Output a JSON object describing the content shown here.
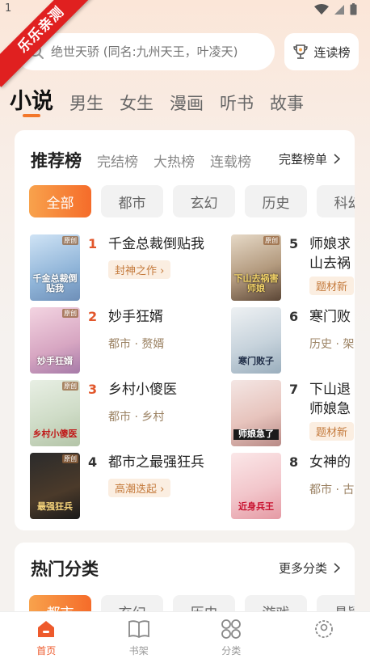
{
  "status": {
    "time": "1"
  },
  "watermark": "乐乐亲测",
  "search": {
    "placeholder": "绝世天骄 (同名:九州天王，叶凌天)"
  },
  "rank_button": {
    "label": "连读榜"
  },
  "main_tabs": [
    "小说",
    "男生",
    "女生",
    "漫画",
    "听书",
    "故事"
  ],
  "recommend": {
    "tabs": [
      "推荐榜",
      "完结榜",
      "大热榜",
      "连载榜"
    ],
    "more_label": "完整榜单",
    "chips": [
      "全部",
      "都市",
      "玄幻",
      "历史",
      "科幻"
    ],
    "books": [
      {
        "rank": "1",
        "title": "千金总裁倒贴我",
        "tag": "封神之作",
        "cover_text": "千金总裁倒贴我",
        "badge": "原创"
      },
      {
        "rank": "2",
        "title": "妙手狂婿",
        "sub": "都市 · 赘婿",
        "cover_text": "妙手狂婿",
        "badge": "原创"
      },
      {
        "rank": "3",
        "title": "乡村小傻医",
        "sub": "都市 · 乡村",
        "cover_text": "乡村小傻医",
        "badge": "原创"
      },
      {
        "rank": "4",
        "title": "都市之最强狂兵",
        "tag": "高潮迭起",
        "cover_text": "最强狂兵",
        "badge": "原创"
      },
      {
        "rank": "5",
        "title": "师娘求",
        "title2": "山去祸",
        "tag": "题材新",
        "cover_text": "下山去祸害师娘",
        "badge": "原创"
      },
      {
        "rank": "6",
        "title": "寒门败",
        "sub": "历史 · 架",
        "cover_text": "寒门败子",
        "badge": ""
      },
      {
        "rank": "7",
        "title": "下山退",
        "title2": "师娘急",
        "tag": "题材新",
        "cover_text": "师娘急了",
        "badge": ""
      },
      {
        "rank": "8",
        "title": "女神的",
        "sub": "都市 · 古",
        "cover_text": "近身兵王",
        "badge": ""
      }
    ]
  },
  "categories": {
    "title": "热门分类",
    "more_label": "更多分类",
    "chips": [
      "都市",
      "玄幻",
      "历史",
      "游戏",
      "悬疑"
    ]
  },
  "bottom_nav": [
    {
      "label": "首页",
      "icon": "home-icon"
    },
    {
      "label": "书架",
      "icon": "bookshelf-icon"
    },
    {
      "label": "分类",
      "icon": "category-icon"
    },
    {
      "label": "",
      "icon": "profile-icon"
    }
  ],
  "colors": {
    "accent": "#f3772a",
    "rank_top": "#e2572c",
    "ribbon": "#e02020"
  }
}
